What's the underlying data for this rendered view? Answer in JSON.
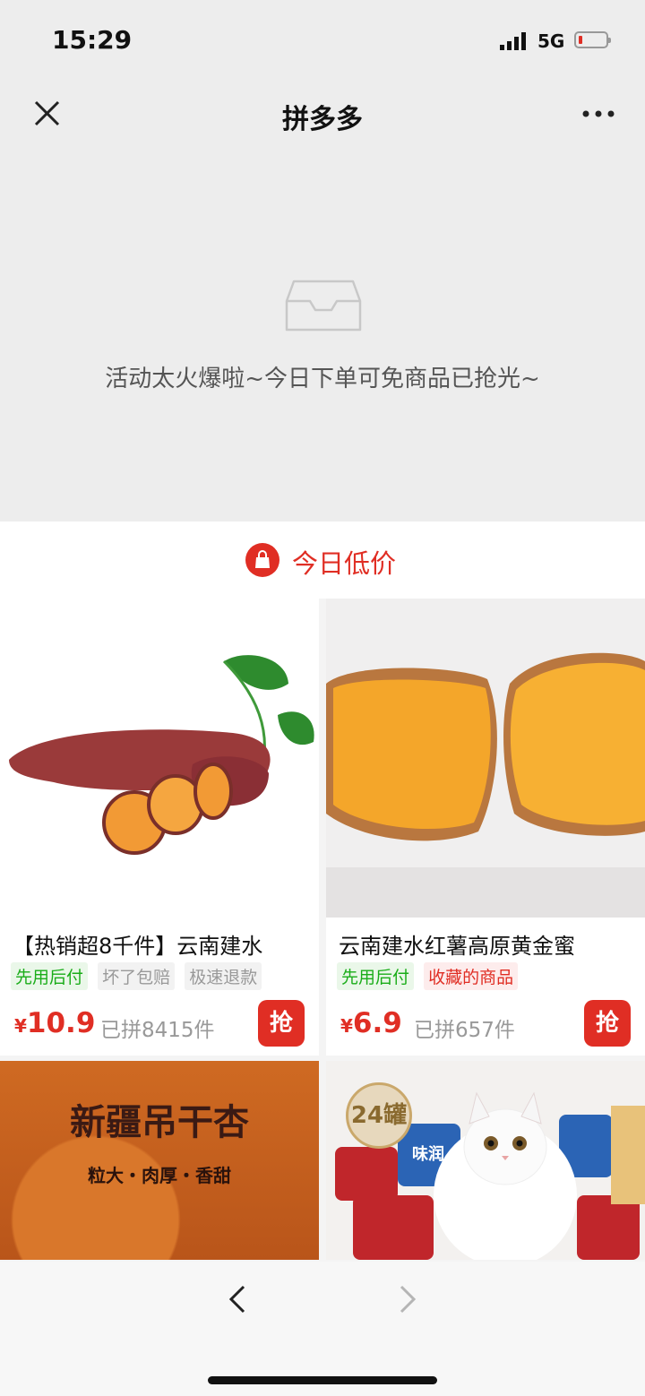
{
  "status_bar": {
    "time": "15:29",
    "network": "5G",
    "battery_level": 0.08
  },
  "nav": {
    "title": "拼多多",
    "close_icon": "close-icon",
    "more_icon": "more-icon"
  },
  "empty_state": {
    "icon": "inbox-icon",
    "message": "活动太火爆啦~今日下单可免商品已抢光~"
  },
  "section": {
    "icon": "shopping-bag-icon",
    "title": "今日低价",
    "accent": "#e02e24"
  },
  "products": [
    {
      "title": "【热销超8千件】云南建水",
      "tags": [
        {
          "text": "先用后付",
          "style": "green"
        },
        {
          "text": "坏了包赔",
          "style": "gray"
        },
        {
          "text": "极速退款",
          "style": "gray"
        }
      ],
      "currency": "¥",
      "price": "10.9",
      "sold": "已拼8415件",
      "button": "抢"
    },
    {
      "title": "云南建水红薯高原黄金蜜",
      "tags": [
        {
          "text": "先用后付",
          "style": "green"
        },
        {
          "text": "收藏的商品",
          "style": "red"
        }
      ],
      "currency": "¥",
      "price": "6.9",
      "sold": "已拼657件",
      "button": "抢"
    },
    {
      "image_title": "新疆吊干杏",
      "image_subtitle": "粒大・肉厚・香甜"
    },
    {
      "image_badge": "24罐",
      "can_label": "味润"
    }
  ],
  "toolbar": {
    "back_icon": "chevron-left-icon",
    "forward_icon": "chevron-right-icon"
  }
}
